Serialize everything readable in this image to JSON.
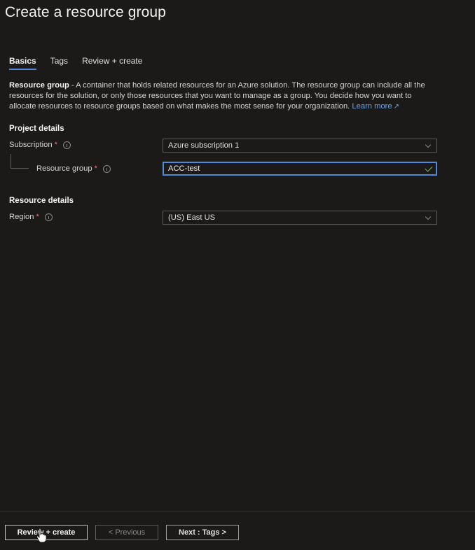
{
  "page": {
    "title": "Create a resource group"
  },
  "tabs": [
    {
      "label": "Basics",
      "active": true
    },
    {
      "label": "Tags",
      "active": false
    },
    {
      "label": "Review + create",
      "active": false
    }
  ],
  "description": {
    "bold": "Resource group",
    "text": " - A container that holds related resources for an Azure solution. The resource group can include all the resources for the solution, or only those resources that you want to manage as a group. You decide how you want to allocate resources to resource groups based on what makes the most sense for your organization. ",
    "link": "Learn more"
  },
  "project_details": {
    "heading": "Project details",
    "subscription": {
      "label": "Subscription",
      "required": "*",
      "value": "Azure subscription 1"
    },
    "resource_group": {
      "label": "Resource group",
      "required": "*",
      "value": "ACC-test"
    }
  },
  "resource_details": {
    "heading": "Resource details",
    "region": {
      "label": "Region",
      "required": "*",
      "value": "(US) East US"
    }
  },
  "footer": {
    "review_create": "Review + create",
    "previous": "< Previous",
    "next": "Next : Tags >"
  },
  "colors": {
    "accent": "#4f8ad9",
    "required": "#f1707b",
    "valid": "#7fba62",
    "background": "#1b1a19"
  }
}
